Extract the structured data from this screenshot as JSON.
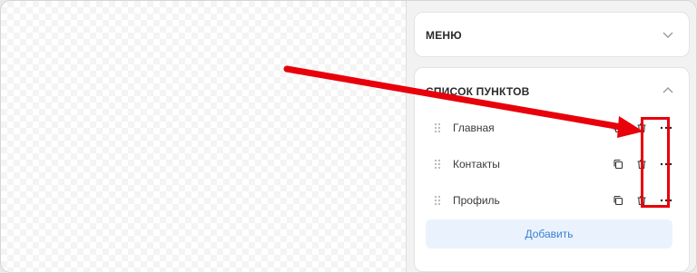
{
  "panel": {
    "menu_section": {
      "title": "МЕНЮ",
      "expanded": false
    },
    "list_section": {
      "title": "СПИСОК ПУНКТОВ",
      "expanded": true,
      "items": [
        {
          "label": "Главная"
        },
        {
          "label": "Контакты"
        },
        {
          "label": "Профиль"
        }
      ],
      "add_label": "Добавить"
    }
  },
  "colors": {
    "annotation": "#e8000b",
    "accent": "#3b7fd6",
    "accent_bg": "#eaf3fd"
  },
  "icons": {
    "drag": "drag-handle-icon",
    "copy": "copy-icon",
    "delete": "trash-icon",
    "more": "more-dots-icon",
    "expand": "chevron-down-icon",
    "collapse": "chevron-up-icon"
  }
}
